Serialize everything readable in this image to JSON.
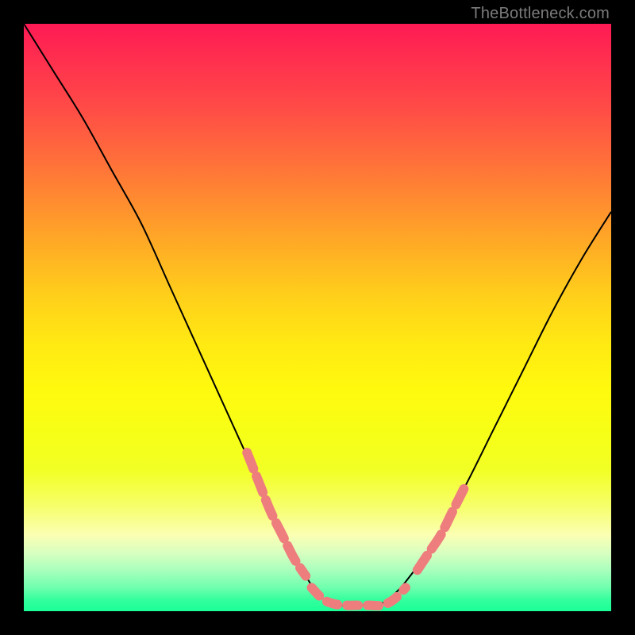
{
  "watermark": "TheBottleneck.com",
  "chart_data": {
    "type": "line",
    "title": "",
    "xlabel": "",
    "ylabel": "",
    "xlim": [
      0,
      100
    ],
    "ylim": [
      0,
      100
    ],
    "grid": false,
    "legend": false,
    "series": [
      {
        "name": "curve",
        "color": "#000000",
        "x": [
          0,
          5,
          10,
          15,
          20,
          25,
          30,
          35,
          40,
          45,
          48,
          50,
          52,
          54,
          56,
          58,
          60,
          62,
          65,
          70,
          75,
          80,
          85,
          90,
          95,
          100
        ],
        "y": [
          100,
          92,
          84,
          75,
          66,
          55,
          44,
          33,
          22,
          11,
          6,
          3,
          1.5,
          1,
          1,
          1,
          1,
          2,
          5,
          12,
          21,
          31,
          41,
          51,
          60,
          68
        ]
      },
      {
        "name": "left-highlight",
        "color": "#ee7e7e",
        "style": "dashed-thick",
        "x": [
          38,
          40,
          42,
          44,
          46,
          48
        ],
        "y": [
          27,
          22,
          17,
          13,
          9,
          6
        ]
      },
      {
        "name": "bottom-highlight",
        "color": "#ee7e7e",
        "style": "dotted-thick",
        "x": [
          49,
          51,
          53,
          55,
          57,
          59,
          61,
          63,
          65
        ],
        "y": [
          4,
          2,
          1.2,
          1,
          1,
          1,
          1,
          2,
          4
        ]
      },
      {
        "name": "right-highlight",
        "color": "#ee7e7e",
        "style": "dashed-thick",
        "x": [
          67,
          69,
          71,
          73,
          75
        ],
        "y": [
          7,
          10,
          13,
          17,
          21
        ]
      }
    ],
    "annotations": []
  }
}
